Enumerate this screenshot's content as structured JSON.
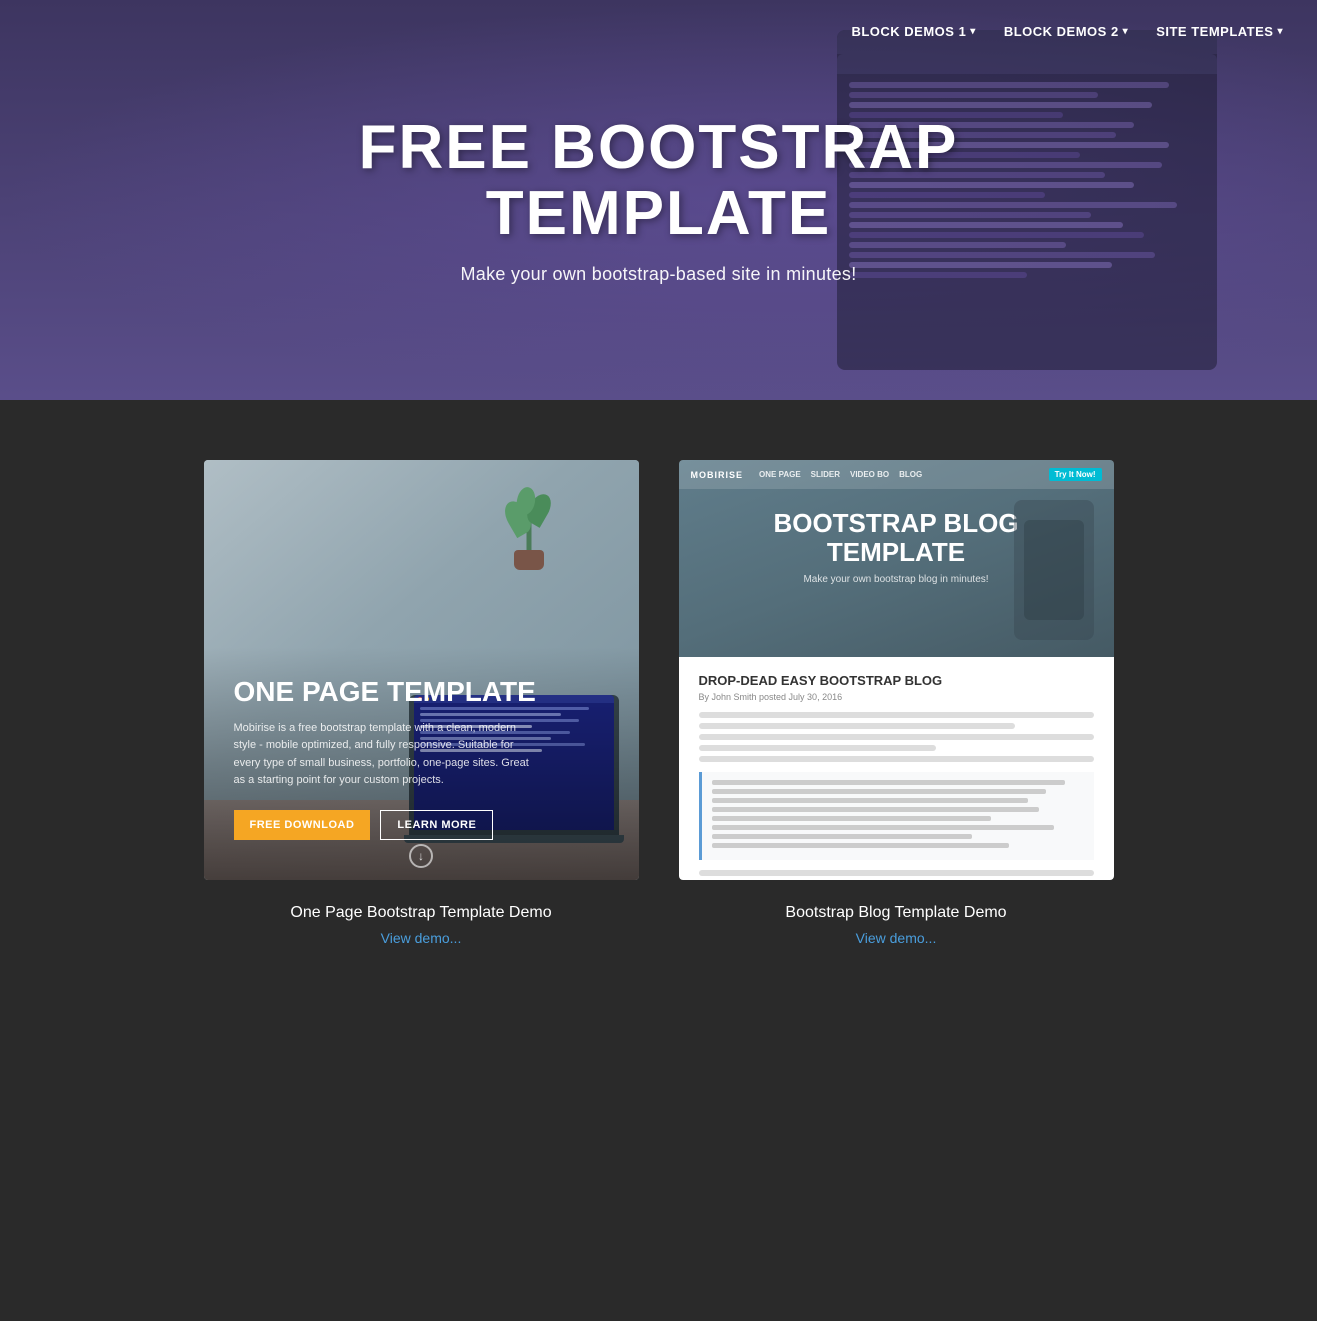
{
  "nav": {
    "items": [
      {
        "label": "BLOCK DEMOS 1",
        "has_dropdown": true
      },
      {
        "label": "BLOCK DEMOS 2",
        "has_dropdown": true
      },
      {
        "label": "SITE TEMPLATES",
        "has_dropdown": true
      }
    ]
  },
  "hero": {
    "title": "FREE BOOTSTRAP\nTEMPLATE",
    "subtitle": "Make your own bootstrap-based site in minutes!"
  },
  "cards": [
    {
      "id": "one-page",
      "image_alt": "One Page Template Preview",
      "template_title": "ONE PAGE TEMPLATE",
      "description": "Mobirise is a free bootstrap template with a clean, modern style - mobile optimized, and fully responsive. Suitable for every type of small business, portfolio, one-page sites. Great as a starting point for your custom projects.",
      "btn_primary": "FREE DOWNLOAD",
      "btn_secondary": "LEARN MORE",
      "label": "One Page Bootstrap Template Demo",
      "link": "View demo..."
    },
    {
      "id": "blog",
      "image_alt": "Bootstrap Blog Template Preview",
      "nav_logo": "MOBIRISE",
      "nav_items": [
        "ONE PAGE",
        "SLIDER",
        "VIDEO BO",
        "BLOG"
      ],
      "nav_cta": "Try It Now!",
      "blog_title": "BOOTSTRAP BLOG\nTEMPLATE",
      "blog_subtitle": "Make your own bootstrap blog in minutes!",
      "article_title": "DROP-DEAD EASY BOOTSTRAP BLOG",
      "article_byline": "By John Smith posted July 30, 2016",
      "label": "Bootstrap Blog Template Demo",
      "link": "View demo..."
    }
  ],
  "colors": {
    "hero_bg": "#5a4e8a",
    "body_bg": "#2a2a2a",
    "accent_blue": "#4a9edd",
    "btn_orange": "#f5a623",
    "nav_cyan": "#00bcd4"
  }
}
